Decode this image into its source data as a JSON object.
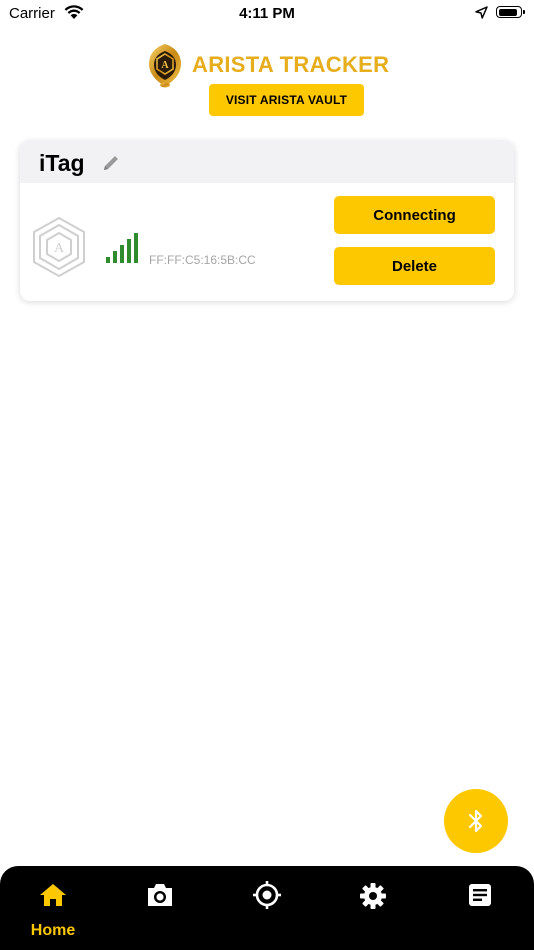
{
  "status_bar": {
    "carrier": "Carrier",
    "time": "4:11 PM",
    "battery_level": 0.9
  },
  "header": {
    "brand_name": "ARISTA TRACKER",
    "vault_button": "VISIT ARISTA VAULT",
    "brand_color": "#e6ad1c"
  },
  "device": {
    "name": "iTag",
    "mac": "FF:FF:C5:16:5B:CC",
    "signal_bars": 5,
    "primary_action": "Connecting",
    "secondary_action": "Delete",
    "signal_color": "#2e8b2e"
  },
  "fab": {
    "icon": "bluetooth-icon"
  },
  "tab_bar": {
    "active": "home",
    "tabs": [
      {
        "id": "home",
        "label": "Home",
        "icon": "home-icon"
      },
      {
        "id": "camera",
        "label": "",
        "icon": "camera-icon"
      },
      {
        "id": "locate",
        "label": "",
        "icon": "crosshair-icon"
      },
      {
        "id": "settings",
        "label": "",
        "icon": "gear-icon"
      },
      {
        "id": "notes",
        "label": "",
        "icon": "note-icon"
      }
    ]
  },
  "colors": {
    "accent": "#fdc800",
    "tab_bar": "#000000",
    "card_header": "#f2f2f5"
  }
}
